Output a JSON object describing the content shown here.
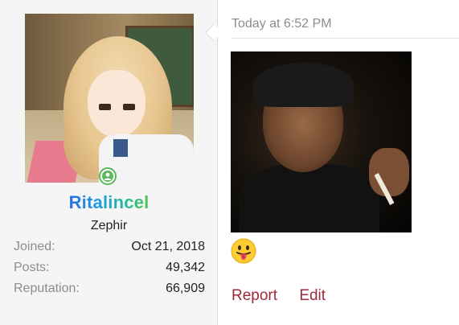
{
  "user": {
    "username": "Ritalincel",
    "title": "Zephir",
    "online": true,
    "stats": [
      {
        "label": "Joined:",
        "value": "Oct 21, 2018"
      },
      {
        "label": "Posts:",
        "value": "49,342"
      },
      {
        "label": "Reputation:",
        "value": "66,909"
      }
    ]
  },
  "message": {
    "date": "Today at 6:52 PM",
    "emoji": "tongue-out-emoji",
    "actions": {
      "report": "Report",
      "edit": "Edit"
    }
  },
  "colors": {
    "link": "#9c2a3a",
    "online": "#5cb85c",
    "muted": "#8c8c8c"
  }
}
